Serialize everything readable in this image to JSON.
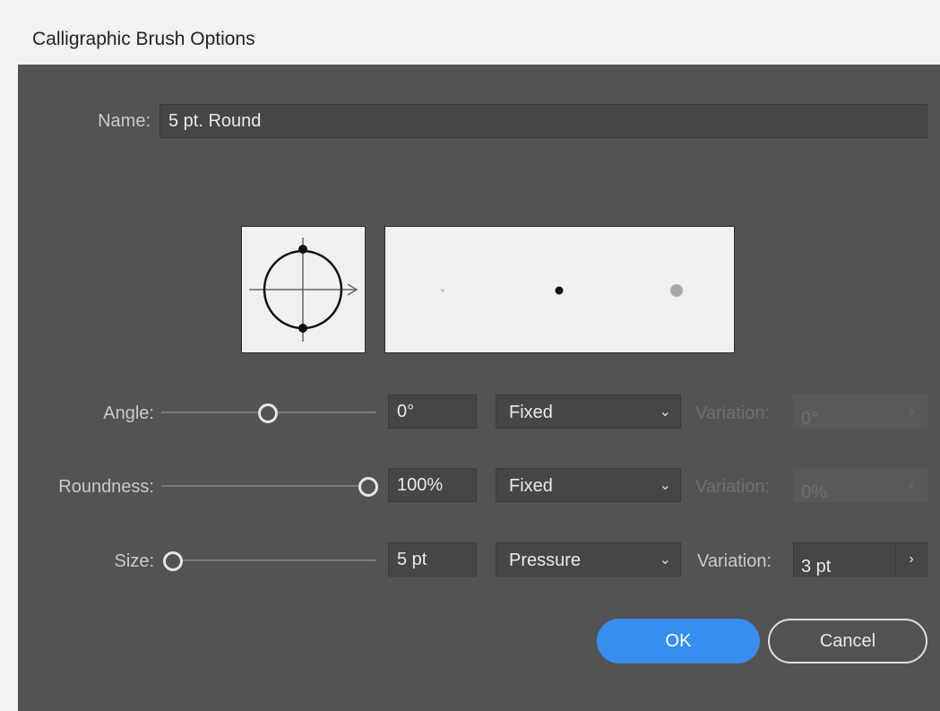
{
  "window": {
    "title": "Calligraphic Brush Options"
  },
  "name": {
    "label": "Name:",
    "value": "5 pt. Round"
  },
  "angle": {
    "label": "Angle:",
    "value": "0°",
    "mode": "Fixed",
    "variation_label": "Variation:",
    "variation_value": "0°",
    "variation_enabled": false
  },
  "roundness": {
    "label": "Roundness:",
    "value": "100%",
    "mode": "Fixed",
    "variation_label": "Variation:",
    "variation_value": "0%",
    "variation_enabled": false
  },
  "size": {
    "label": "Size:",
    "value": "5 pt",
    "mode": "Pressure",
    "variation_label": "Variation:",
    "variation_value": "3 pt",
    "variation_enabled": true
  },
  "buttons": {
    "ok": "OK",
    "cancel": "Cancel"
  },
  "icons": {
    "dropdown": "chevron-down-icon",
    "stepper": "chevron-right-icon"
  },
  "colors": {
    "dialog_bg": "#535353",
    "accent": "#378ef0"
  }
}
